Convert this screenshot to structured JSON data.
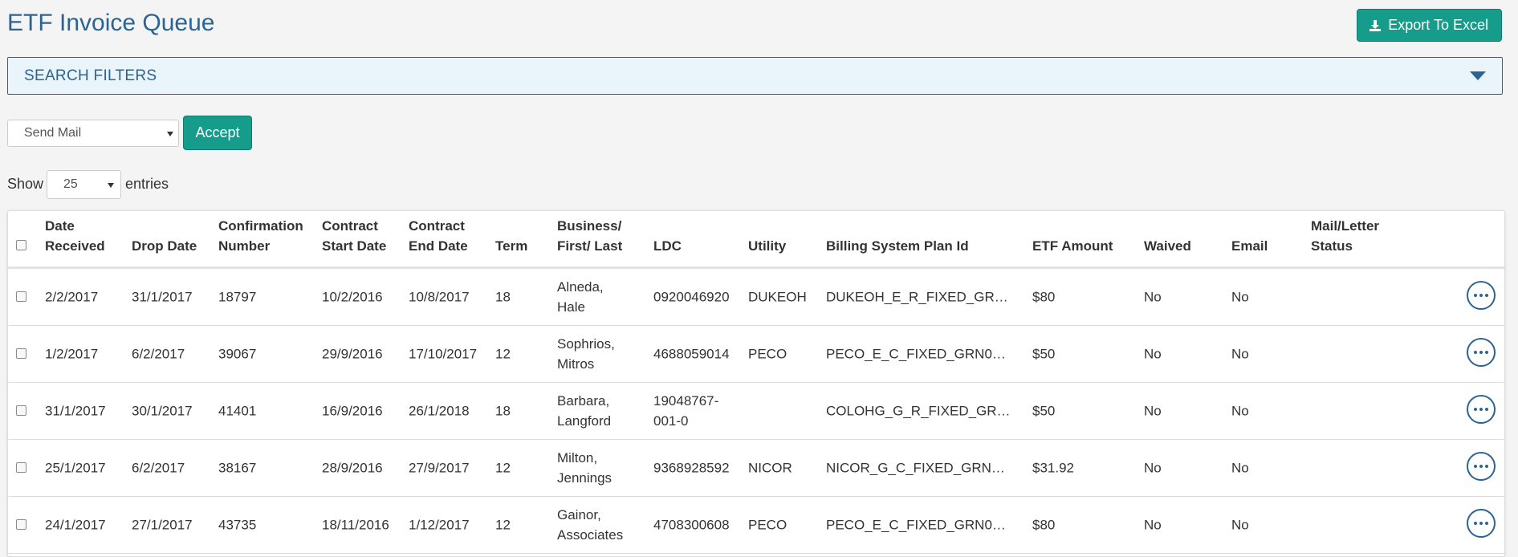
{
  "page": {
    "title": "ETF Invoice Queue",
    "export_label": "Export To Excel",
    "search_filters_label": "SEARCH FILTERS"
  },
  "actions": {
    "selected": "Send Mail",
    "accept_label": "Accept"
  },
  "paging": {
    "show_label": "Show",
    "entries_value": "25",
    "entries_label": "entries"
  },
  "table": {
    "headers": {
      "date_received": "Date Received",
      "drop_date": "Drop Date",
      "confirmation": "Confirmation Number",
      "start": "Contract Start Date",
      "end": "Contract End Date",
      "term": "Term",
      "business": "Business/ First/ Last",
      "ldc": "LDC",
      "utility": "Utility",
      "plan": "Billing System Plan Id",
      "etf": "ETF Amount",
      "waived": "Waived",
      "email": "Email",
      "status": "Mail/Letter Status"
    },
    "rows": [
      {
        "date_received": "2/2/2017",
        "drop_date": "31/1/2017",
        "confirmation": "18797",
        "start": "10/2/2016",
        "end": "10/8/2017",
        "term": "18",
        "business": "Alneda, Hale",
        "ldc": "0920046920",
        "utility": "DUKEOH",
        "plan": "DUKEOH_E_R_FIXED_GR…",
        "etf": "$80",
        "waived": "No",
        "email": "No",
        "status": ""
      },
      {
        "date_received": "1/2/2017",
        "drop_date": "6/2/2017",
        "confirmation": "39067",
        "start": "29/9/2016",
        "end": "17/10/2017",
        "term": "12",
        "business": "Sophrios, Mitros",
        "ldc": "4688059014",
        "utility": "PECO",
        "plan": "PECO_E_C_FIXED_GRN0…",
        "etf": "$50",
        "waived": "No",
        "email": "No",
        "status": ""
      },
      {
        "date_received": "31/1/2017",
        "drop_date": "30/1/2017",
        "confirmation": "41401",
        "start": "16/9/2016",
        "end": "26/1/2018",
        "term": "18",
        "business": "Barbara, Langford",
        "ldc": "19048767-001-0",
        "utility": "",
        "plan": "COLOHG_G_R_FIXED_GR…",
        "etf": "$50",
        "waived": "No",
        "email": "No",
        "status": ""
      },
      {
        "date_received": "25/1/2017",
        "drop_date": "6/2/2017",
        "confirmation": "38167",
        "start": "28/9/2016",
        "end": "27/9/2017",
        "term": "12",
        "business": "Milton, Jennings",
        "ldc": "9368928592",
        "utility": "NICOR",
        "plan": "NICOR_G_C_FIXED_GRN…",
        "etf": "$31.92",
        "waived": "No",
        "email": "No",
        "status": ""
      },
      {
        "date_received": "24/1/2017",
        "drop_date": "27/1/2017",
        "confirmation": "43735",
        "start": "18/11/2016",
        "end": "1/12/2017",
        "term": "12",
        "business": "Gainor, Associates",
        "ldc": "4708300608",
        "utility": "PECO",
        "plan": "PECO_E_C_FIXED_GRN0…",
        "etf": "$80",
        "waived": "No",
        "email": "No",
        "status": ""
      }
    ]
  }
}
